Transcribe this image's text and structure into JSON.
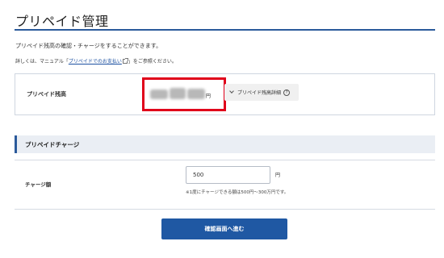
{
  "header": {
    "title": "プリペイド管理"
  },
  "intro": {
    "text": "プリペイド残高の確認・チャージをすることができます。"
  },
  "detail_line": {
    "prefix": "詳しくは、マニュアル「",
    "link": "プリペイドでのお支払い",
    "suffix": "」をご参照ください。"
  },
  "balance": {
    "label": "プリペイド残高",
    "unit": "円",
    "detail_button": "プリペイド残高詳細",
    "help_icon": "?"
  },
  "charge": {
    "section_title": "プリペイドチャージ",
    "amount_label": "チャージ額",
    "amount_value": "500",
    "amount_unit": "円",
    "note": "※1度にチャージできる額は500円〜300万円です。"
  },
  "actions": {
    "confirm_label": "確認画面へ進む"
  }
}
